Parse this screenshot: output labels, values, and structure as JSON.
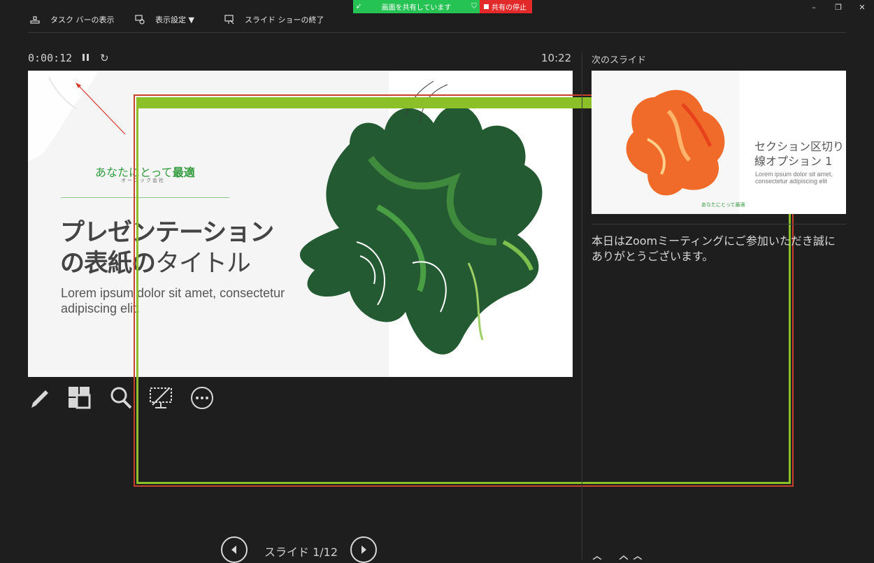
{
  "toolbar": {
    "taskbar_label": "タスク バーの表示",
    "display_settings_label": "表示設定 ▼",
    "end_show_label": "スライド ショーの終了"
  },
  "share": {
    "status_label": "画面を共有しています",
    "stop_label": "共有の停止"
  },
  "presenter": {
    "elapsed": "0:00:12",
    "clock": "10:22"
  },
  "slide": {
    "brand_normal": "あなたにとって",
    "brand_bold": "最適",
    "brand_sub": "オーニック会社",
    "title_line1": "プレゼンテーション",
    "title_line2_bold": "の表紙の",
    "title_line2_light": "タイトル",
    "subtitle": "Lorem ipsum dolor sit amet, consectetur adipiscing elit."
  },
  "next": {
    "label": "次のスライド",
    "title": "セクション区切り線オプション 1",
    "body": "Lorem ipsum dolor sit amet, consectetur adipiscing elit",
    "brand": "あなたにとって最適"
  },
  "notes": "本日はZoomミーティングにご参加いただき誠にありがとうございます。",
  "nav": {
    "counter": "スライド 1/12"
  },
  "colors": {
    "share_green": "#25c254",
    "share_red": "#e22a2a",
    "frame_green": "#8cc029",
    "brand_green": "#2f9a3c"
  }
}
